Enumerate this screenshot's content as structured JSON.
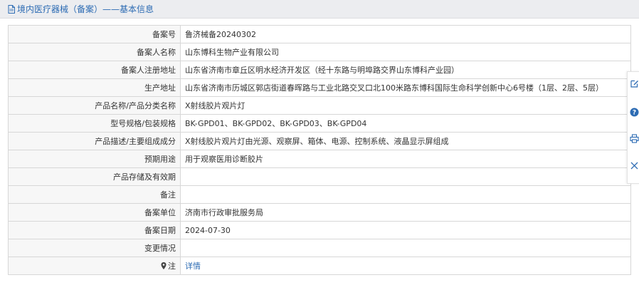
{
  "header": {
    "title": "境内医疗器械（备案）——基本信息"
  },
  "rows": [
    {
      "label": "备案号",
      "value": "鲁济械备20240302"
    },
    {
      "label": "备案人名称",
      "value": "山东博科生物产业有限公司"
    },
    {
      "label": "备案人注册地址",
      "value": "山东省济南市章丘区明水经济开发区（经十东路与明埠路交界山东博科产业园）"
    },
    {
      "label": "生产地址",
      "value": "山东省济南市历城区郭店街道春晖路与工业北路交叉口北100米路东博科国际生命科学创新中心6号楼（1层、2层、5层）"
    },
    {
      "label": "产品名称/产品分类名称",
      "value": "X射线胶片观片灯"
    },
    {
      "label": "型号规格/包装规格",
      "value": "BK-GPD01、BK-GPD02、BK-GPD03、BK-GPD04"
    },
    {
      "label": "产品描述/主要组成成分",
      "value": "X射线胶片观片灯由光源、观察屏、箱体、电源、控制系统、液晶显示屏组成"
    },
    {
      "label": "预期用途",
      "value": "用于观察医用诊断胶片"
    },
    {
      "label": "产品存储及有效期",
      "value": ""
    },
    {
      "label": "备注",
      "value": ""
    },
    {
      "label": "备案单位",
      "value": "济南市行政审批服务局"
    },
    {
      "label": "备案日期",
      "value": "2024-07-30"
    },
    {
      "label": "变更情况",
      "value": ""
    },
    {
      "label": "注",
      "value": "详情"
    }
  ],
  "side_tools": [
    "edit-icon",
    "help-icon",
    "print-icon",
    "close-icon"
  ],
  "colors": {
    "accent": "#2c6bb3",
    "header_bg": "#ecedf0",
    "label_bg": "#f7f7f7",
    "border": "#d7d7d7"
  }
}
